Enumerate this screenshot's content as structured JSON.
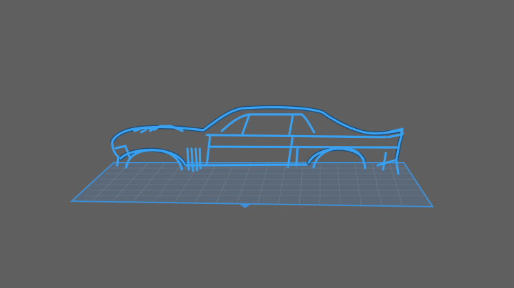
{
  "viewport": {
    "background_color": "#5f5f5f",
    "object": "car-silhouette-wireframe",
    "object_color": "#3aa0f0",
    "object_outline_color": "#1e4f7a",
    "bed_color": "#5b6a7c",
    "bed_line_color": "#3f8fd6",
    "bed_grid_color": "#7b8898",
    "origin_marker_color": "#3f8fd6"
  }
}
